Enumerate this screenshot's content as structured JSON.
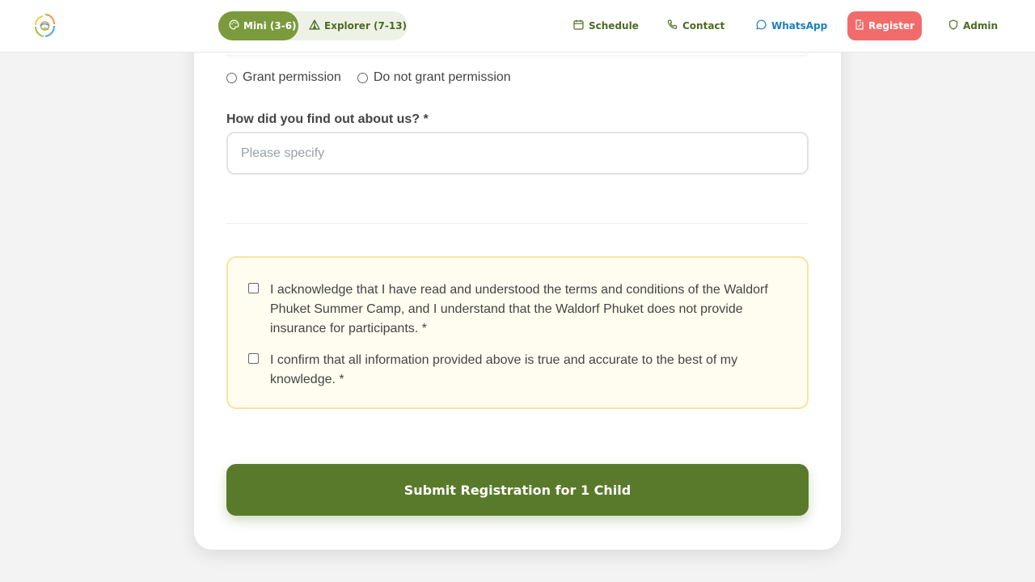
{
  "header": {
    "modes": [
      {
        "label": "Mini (3-6)",
        "icon": "palette-icon",
        "active": true
      },
      {
        "label": "Explorer (7-13)",
        "icon": "tent-icon",
        "active": false
      }
    ],
    "nav": {
      "schedule": "Schedule",
      "contact": "Contact",
      "whatsapp": "WhatsApp",
      "register": "Register",
      "admin": "Admin"
    }
  },
  "form": {
    "permission_options": [
      "Grant permission",
      "Do not grant permission"
    ],
    "referral_label": "How did you find out about us? *",
    "referral_placeholder": "Please specify",
    "referral_value": "",
    "consents": [
      {
        "text": "I acknowledge that I have read and understood the terms and conditions of the Waldorf Phuket Summer Camp, and I understand that the Waldorf Phuket does not provide insurance for participants. *",
        "checked": false
      },
      {
        "text": "I confirm that all information provided above is true and accurate to the best of my knowledge. *",
        "checked": false
      }
    ],
    "submit_label": "Submit Registration for 1 Child"
  },
  "colors": {
    "primary": "#5a7a2b",
    "active_mode": "#7a9a3c",
    "register": "#f26b6b",
    "whatsapp": "#1a7fc0",
    "consent_bg": "#fffdef",
    "consent_border": "#f7e3a1"
  }
}
